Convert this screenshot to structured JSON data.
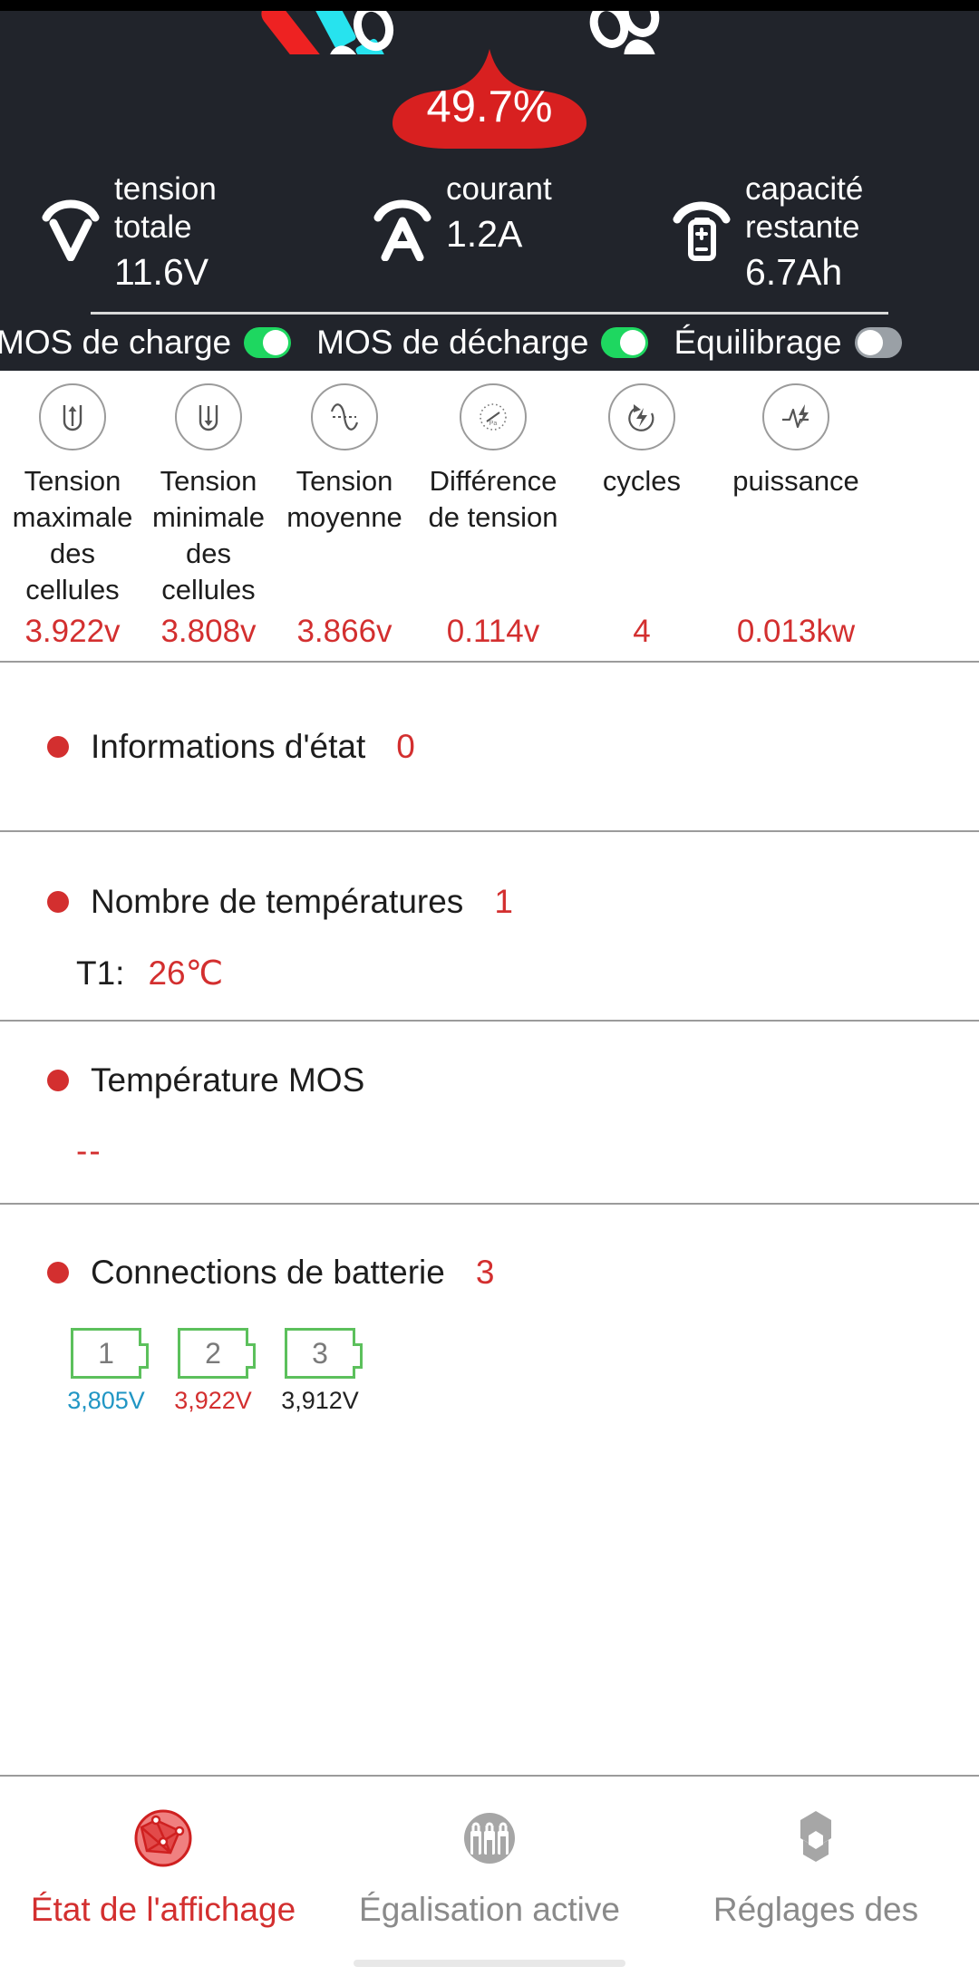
{
  "header": {
    "soc": "49.7%",
    "soc_color": "#d82020",
    "metrics": [
      {
        "icon": "voltmeter-icon",
        "label_line1": "tension",
        "label_line2": "totale",
        "value": "11.6V"
      },
      {
        "icon": "ammeter-icon",
        "label_line1": "courant",
        "label_line2": "",
        "value": "1.2A"
      },
      {
        "icon": "battery-capacity-icon",
        "label_line1": "capacité",
        "label_line2": "restante",
        "value": "6.7Ah"
      }
    ],
    "toggles": [
      {
        "label": "MOS de charge",
        "state": "on"
      },
      {
        "label": "MOS de décharge",
        "state": "on"
      },
      {
        "label": "Équilibrage",
        "state": "off"
      }
    ]
  },
  "stats": [
    {
      "icon": "cell-max-voltage-icon",
      "label": "Tension maximale des cellules",
      "value": "3.922v"
    },
    {
      "icon": "cell-min-voltage-icon",
      "label": "Tension minimale des cellules",
      "value": "3.808v"
    },
    {
      "icon": "average-voltage-icon",
      "label": "Tension moyenne",
      "value": "3.866v"
    },
    {
      "icon": "voltage-difference-icon",
      "label": "Différence de tension",
      "value": "0.114v"
    },
    {
      "icon": "cycles-icon",
      "label": "cycles",
      "value": "4"
    },
    {
      "icon": "power-icon",
      "label": "puissance",
      "value": "0.013kw"
    }
  ],
  "sections": {
    "status_info": {
      "title": "Informations d'état",
      "count": "0"
    },
    "temperatures": {
      "title": "Nombre de températures",
      "count": "1",
      "probe_label": "T1:",
      "probe_value": "26℃"
    },
    "mos_temperature": {
      "title": "Température MOS",
      "value": "--"
    },
    "connections": {
      "title": "Connections de batterie",
      "count": "3",
      "cells": [
        {
          "number": "1",
          "voltage": "3,805V",
          "level": "low"
        },
        {
          "number": "2",
          "voltage": "3,922V",
          "level": "high"
        },
        {
          "number": "3",
          "voltage": "3,912V",
          "level": "mid"
        }
      ]
    }
  },
  "bottom_nav": [
    {
      "icon": "network-globe-icon",
      "label": "État de l'affichage",
      "active": true
    },
    {
      "icon": "battery-cells-icon",
      "label": "Égalisation active",
      "active": false
    },
    {
      "icon": "hexagon-settings-icon",
      "label": "Réglages des",
      "active": false
    }
  ],
  "colors": {
    "accent_red": "#d32f2f",
    "toggle_on": "#1ed760",
    "toggle_off": "#9aa0a6",
    "dark_bg": "#21242b",
    "cell_border_green": "#5cc05c",
    "cell_low_blue": "#2196c4"
  }
}
